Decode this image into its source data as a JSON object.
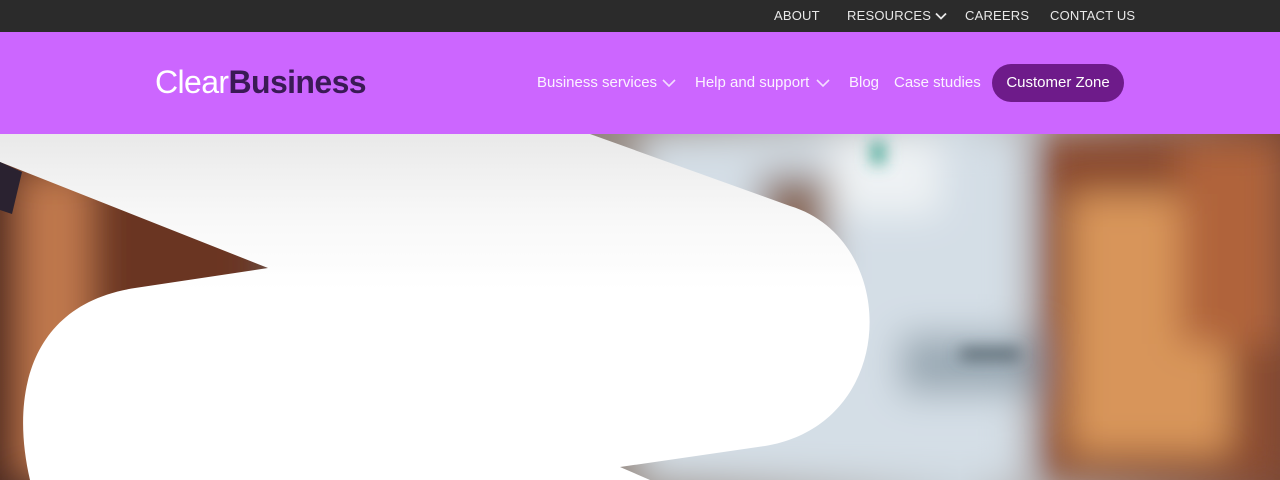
{
  "topbar": {
    "about": "ABOUT",
    "resources": "RESOURCES",
    "careers": "CAREERS",
    "contact": "CONTACT US"
  },
  "nav": {
    "logo_light": "Clear",
    "logo_bold": "Business",
    "business_services": "Business services",
    "help_support": "Help and support",
    "blog": "Blog",
    "case_studies": "Case studies",
    "customer_zone": "Customer Zone"
  },
  "icons": {
    "resources": "chevron-down-icon",
    "business_services": "chevron-down-icon",
    "help_support": "chevron-down-icon"
  },
  "colors": {
    "topbar_bg": "#2b2b2b",
    "nav_bg": "#cc66ff",
    "cta_bg": "#6e1b8a",
    "logo_dark": "#3a1a55"
  }
}
